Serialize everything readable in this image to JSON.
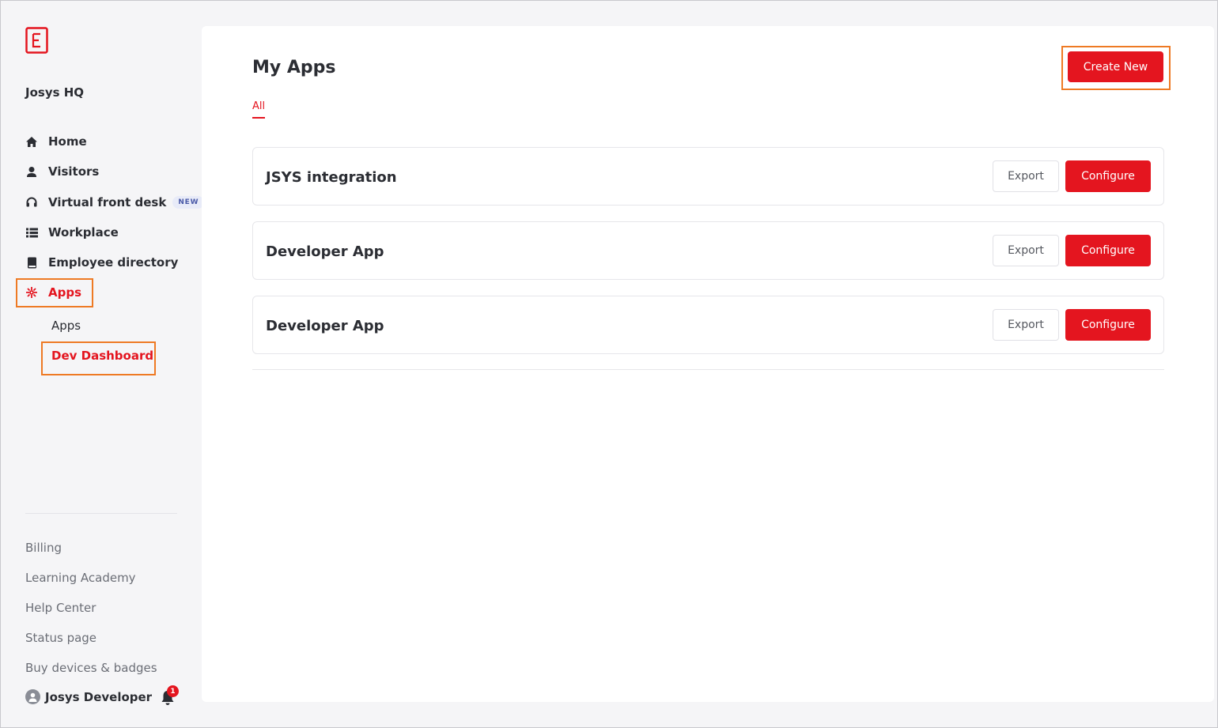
{
  "sidebar": {
    "org_name": "Josys HQ",
    "nav": [
      {
        "label": "Home",
        "icon": "home-icon"
      },
      {
        "label": "Visitors",
        "icon": "visitor-icon"
      },
      {
        "label": "Virtual front desk",
        "icon": "headset-icon",
        "badge": "NEW"
      },
      {
        "label": "Workplace",
        "icon": "list-icon"
      },
      {
        "label": "Employee directory",
        "icon": "book-icon"
      },
      {
        "label": "Apps",
        "icon": "apps-icon",
        "active": true
      }
    ],
    "sub_items": [
      {
        "label": "Apps"
      },
      {
        "label": "Dev Dashboard",
        "active": true
      }
    ],
    "footer_links": [
      "Billing",
      "Learning Academy",
      "Help Center",
      "Status page",
      "Buy devices & badges"
    ],
    "user": {
      "name": "Josys Developer",
      "notification_count": "1"
    }
  },
  "main": {
    "title": "My Apps",
    "tabs": [
      {
        "label": "All",
        "active": true
      }
    ],
    "create_button": "Create New",
    "apps": [
      {
        "name": "JSYS integration",
        "export_label": "Export",
        "configure_label": "Configure"
      },
      {
        "name": "Developer App",
        "export_label": "Export",
        "configure_label": "Configure"
      },
      {
        "name": "Developer App",
        "export_label": "Export",
        "configure_label": "Configure"
      }
    ]
  },
  "colors": {
    "accent": "#e4151f",
    "highlight": "#ee7a24",
    "sidebar_bg": "#f5f5f7"
  }
}
